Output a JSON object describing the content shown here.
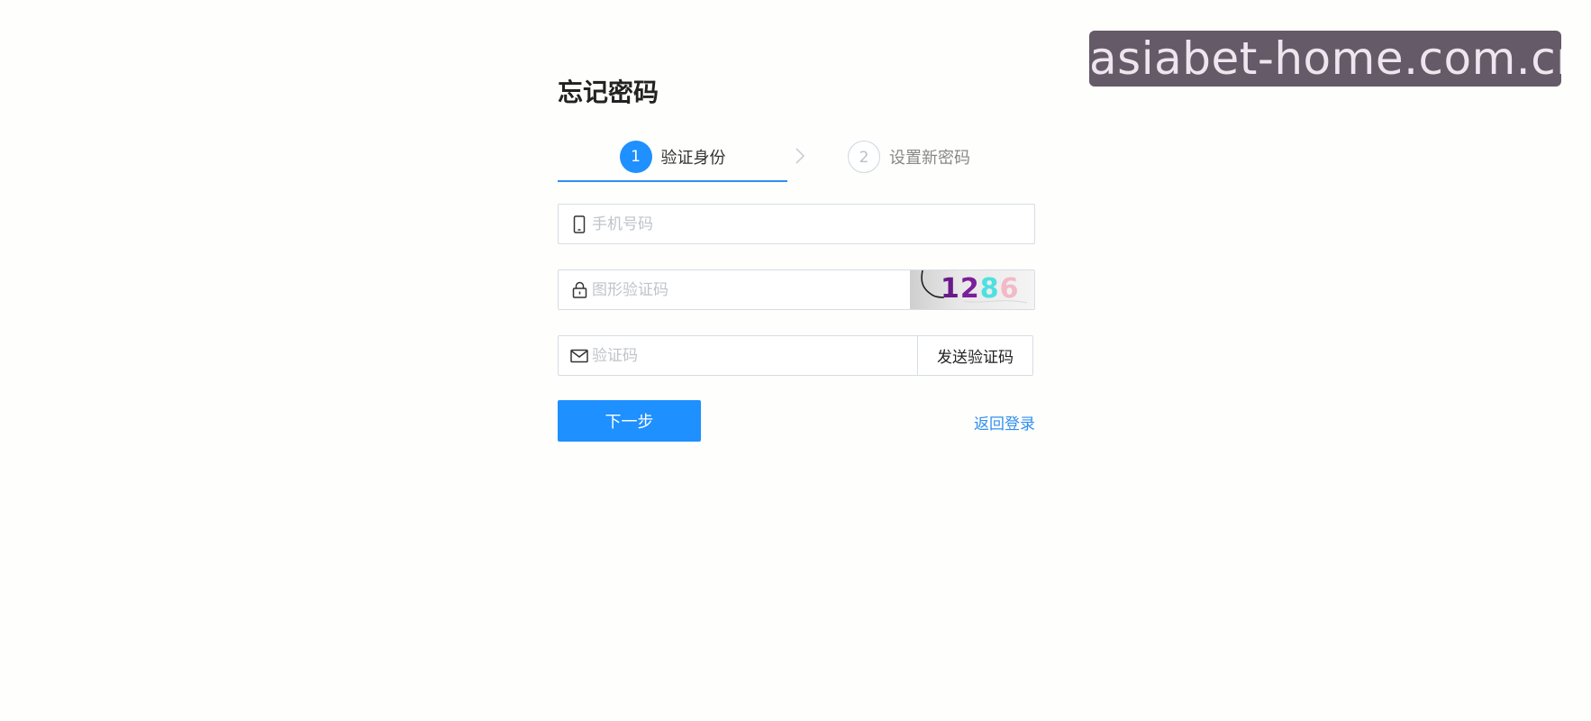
{
  "watermark": {
    "text": "asiabet-home.com.cn"
  },
  "page": {
    "title": "忘记密码"
  },
  "steps": [
    {
      "number": "1",
      "label": "验证身份",
      "active": true
    },
    {
      "number": "2",
      "label": "设置新密码",
      "active": false
    }
  ],
  "form": {
    "phone": {
      "placeholder": "手机号码",
      "icon": "phone-icon"
    },
    "captcha": {
      "placeholder": "图形验证码",
      "icon": "lock-icon",
      "image_digits": [
        "1",
        "2",
        "8",
        "6"
      ]
    },
    "code": {
      "placeholder": "验证码",
      "icon": "mail-icon",
      "send_label": "发送验证码"
    }
  },
  "actions": {
    "next_label": "下一步",
    "back_label": "返回登录"
  },
  "colors": {
    "primary": "#1e90ff",
    "link": "#2f8ff0",
    "border": "#d6dde6",
    "background": "#fefefc"
  }
}
